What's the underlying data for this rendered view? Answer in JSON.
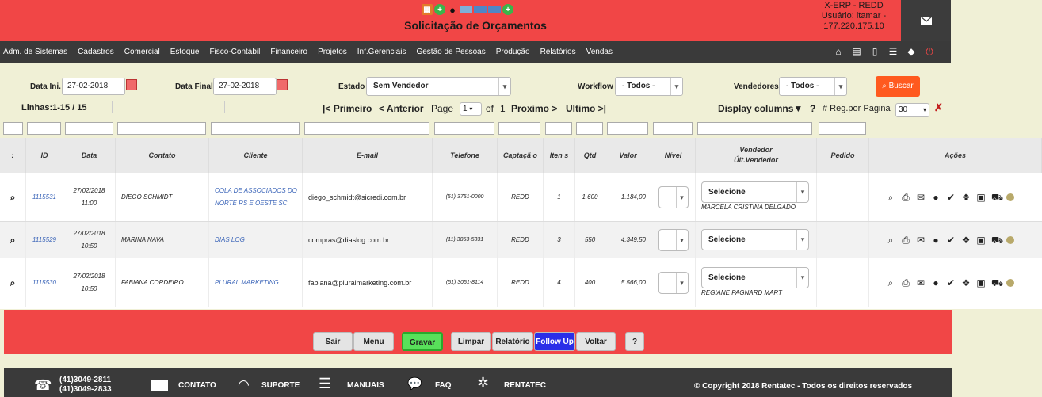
{
  "header": {
    "title": "Solicitação de Orçamentos",
    "system": "X-ERP - REDD",
    "user": "Usuário: itamar -",
    "ip": "177.220.175.10",
    "colors": {
      "primary": "#f14646",
      "dark": "#3a3a3a",
      "accent": "#ff5a1f"
    }
  },
  "menu": [
    "Adm. de Sistemas",
    "Cadastros",
    "Comercial",
    "Estoque",
    "Fisco-Contábil",
    "Financeiro",
    "Projetos",
    "Inf.Gerenciais",
    "Gestão de Pessoas",
    "Produção",
    "Relatórios",
    "Vendas"
  ],
  "filters": {
    "data_ini_label": "Data Ini.",
    "data_ini": "27-02-2018",
    "data_final_label": "Data Final",
    "data_final": "27-02-2018",
    "estado_label": "Estado",
    "estado": "Sem Vendedor",
    "workflow_label": "Workflow",
    "workflow": "- Todos -",
    "vendedores_label": "Vendedores",
    "vendedores": "- Todos -",
    "buscar": "Buscar"
  },
  "pagination": {
    "lines": "Linhas:1-15 / 15",
    "first": "|< Primeiro",
    "prev": "< Anterior",
    "page_label": "Page",
    "page": "1",
    "of": "of",
    "total": "1",
    "next": "Proximo >",
    "last": "Ultimo >|",
    "display_columns": "Display columns",
    "help": "?",
    "reg_label": "# Reg.por Pagina",
    "reg": "30"
  },
  "columns": {
    "sel": ":",
    "id": "ID",
    "data": "Data",
    "contato": "Contato",
    "cliente": "Cliente",
    "email": "E-mail",
    "telefone": "Telefone",
    "captacao": "Captaçã o",
    "itens": "Iten s",
    "qtd": "Qtd",
    "valor": "Valor",
    "nivel": "Nível",
    "vendedor": "Vendedor",
    "ult_vendedor": "Últ.Vendedor",
    "pedido": "Pedido",
    "acoes": "Ações"
  },
  "rows": [
    {
      "id": "1115531",
      "date": "27/02/2018",
      "time": "11:00",
      "contato": "DIEGO SCHMIDT",
      "cliente": "COLA DE ASSOCIADOS DO NORTE RS E OESTE SC",
      "email": "diego_schmidt@sicredi.com.br",
      "telefone": "(51) 3751-0000",
      "captacao": "REDD",
      "itens": "1",
      "qtd": "1.600",
      "valor": "1.184,00",
      "vendedor": "Selecione",
      "ult_vendedor": "MARCELA CRISTINA DELGADO"
    },
    {
      "id": "1115529",
      "date": "27/02/2018",
      "time": "10:50",
      "contato": "MARINA NAVA",
      "cliente": "DIAS LOG",
      "email": "compras@diaslog.com.br",
      "telefone": "(11) 3853-5331",
      "captacao": "REDD",
      "itens": "3",
      "qtd": "550",
      "valor": "4.349,50",
      "vendedor": "Selecione",
      "ult_vendedor": ""
    },
    {
      "id": "1115530",
      "date": "27/02/2018",
      "time": "10:50",
      "contato": "FABIANA CORDEIRO",
      "cliente": "PLURAL MARKETING",
      "email": "fabiana@pluralmarketing.com.br",
      "telefone": "(51) 3051-8114",
      "captacao": "REDD",
      "itens": "4",
      "qtd": "400",
      "valor": "5.566,00",
      "vendedor": "Selecione",
      "ult_vendedor": "REGIANE PAGNARD MART"
    }
  ],
  "buttons": {
    "sair": "Sair",
    "menu": "Menu",
    "gravar": "Gravar",
    "limpar": "Limpar",
    "relatorio": "Relatório",
    "follow": "Follow Up",
    "voltar": "Voltar",
    "help": "?"
  },
  "footer": {
    "phone1": "(41)3049-2811",
    "phone2": "(41)3049-2833",
    "contato": "CONTATO",
    "suporte": "SUPORTE",
    "manuais": "MANUAIS",
    "faq": "FAQ",
    "rentatec": "RENTATEC",
    "copyright": "© Copyright 2018 Rentatec - Todos os direitos reservados"
  }
}
